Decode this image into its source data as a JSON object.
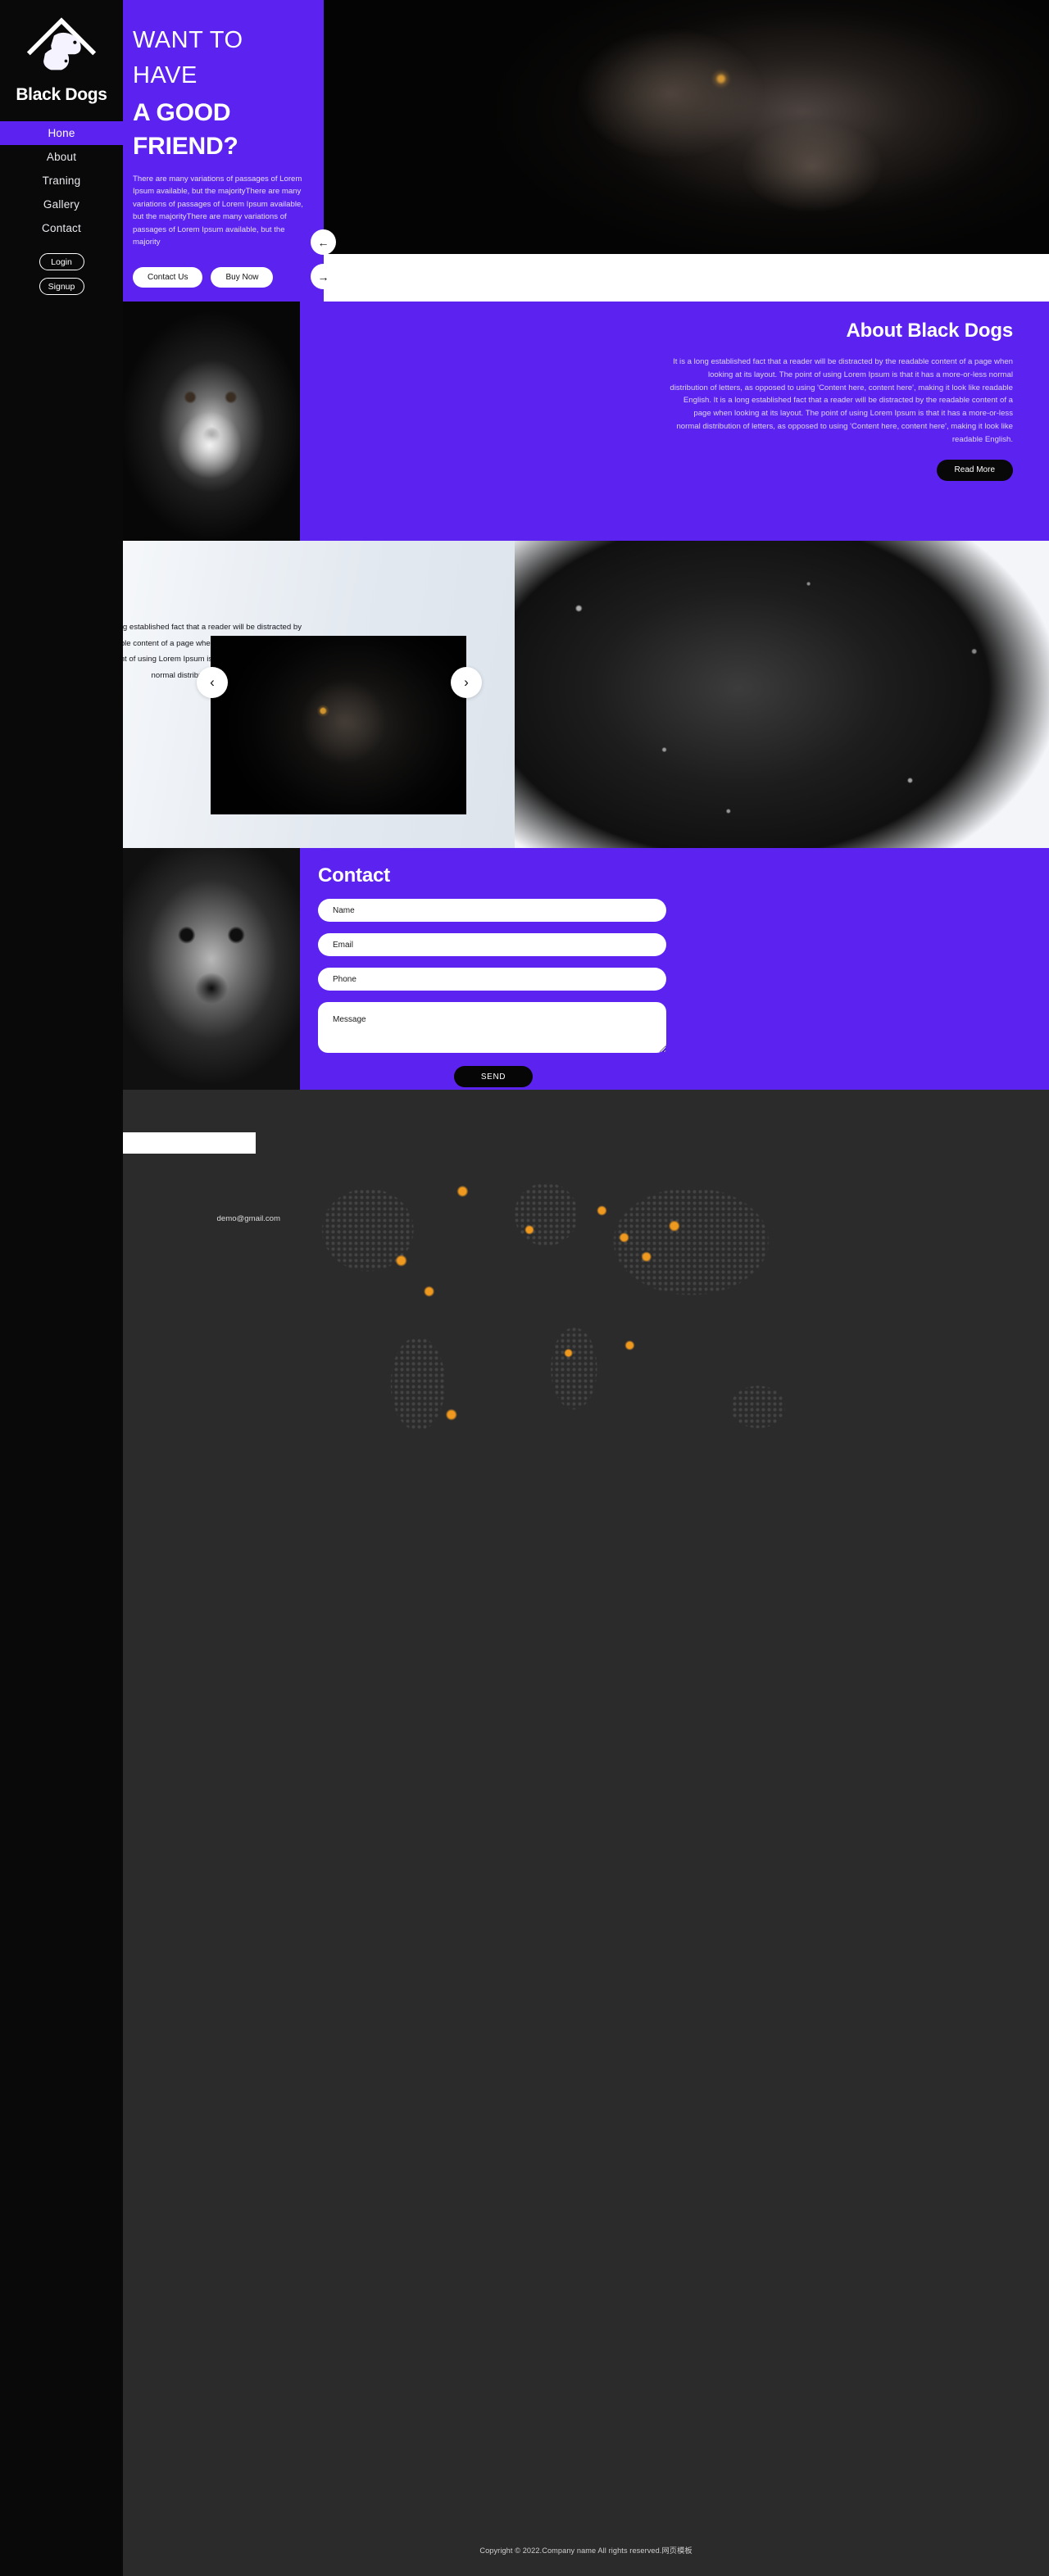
{
  "brand": {
    "name": "Black Dogs",
    "logo_icon": "house-dog-cat-icon"
  },
  "sidebar": {
    "nav": [
      {
        "label": "Hone",
        "active": true
      },
      {
        "label": "About",
        "active": false
      },
      {
        "label": "Traning",
        "active": false
      },
      {
        "label": "Gallery",
        "active": false
      },
      {
        "label": "Contact",
        "active": false
      }
    ],
    "login_label": "Login",
    "signup_label": "Signup"
  },
  "hero": {
    "line1": "WANT TO",
    "line2": "HAVE",
    "line3": "A GOOD",
    "line4": "FRIEND?",
    "paragraph": "There are many variations of passages of Lorem Ipsum available, but the majorityThere are many variations of passages of Lorem Ipsum available, but the majorityThere are many variations of passages of Lorem Ipsum available, but the majority",
    "btn_contact": "Contact Us",
    "btn_buy": "Buy Now",
    "arrow_up": "←",
    "arrow_down": "→"
  },
  "about": {
    "heading": "About Black Dogs",
    "paragraph": "It is a long established fact that a reader will be distracted by the readable content of a page when looking at its layout. The point of using Lorem Ipsum is that it has a more-or-less normal distribution of letters, as opposed to using 'Content here, content here', making it look like readable English. It is a long established fact that a reader will be distracted by the readable content of a page when looking at its layout. The point of using Lorem Ipsum is that it has a more-or-less normal distribution of letters, as opposed to using 'Content here, content here', making it look like readable English.",
    "btn_read_more": "Read More"
  },
  "gallery": {
    "paragraph": "It is a long established fact that a reader will be distracted by the readable content of a page when looking at its layout. The point of using Lorem Ipsum is that it has a more-or-less normal distribution of letters, as opposed to",
    "prev": "‹",
    "next": "›"
  },
  "contact": {
    "heading": "Contact",
    "name_placeholder": "Name",
    "email_placeholder": "Email",
    "phone_placeholder": "Phone",
    "message_placeholder": "Message",
    "send_label": "SEND"
  },
  "footer": {
    "input_value": "",
    "email": "demo@gmail.com",
    "copyright": "Copyright © 2022.Company name All rights reserved.网页模板"
  },
  "colors": {
    "accent": "#5c22ef",
    "dark": "#090909",
    "footer_bg": "#2b2b2b",
    "map_dot": "#f0991f"
  }
}
